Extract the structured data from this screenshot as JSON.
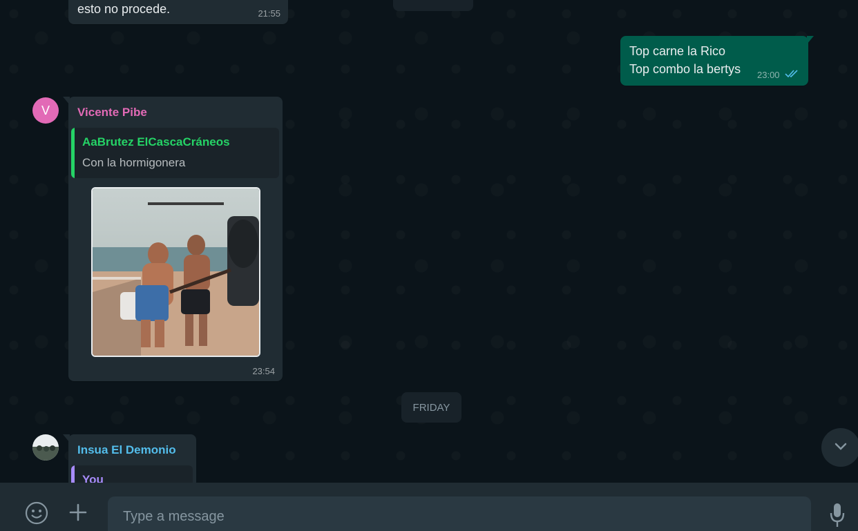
{
  "messages": {
    "m1": {
      "text": "esto no procede.",
      "time": "21:55"
    },
    "m2": {
      "line1": "Top carne la Rico",
      "line2": "Top combo la bertys",
      "time": "23:00"
    },
    "m3": {
      "avatar_letter": "V",
      "sender": "Vicente Pibe",
      "quote_author": "AaBrutez ElCascaCráneos",
      "quote_text": "Con la hormigonera",
      "time": "23:54"
    },
    "m4": {
      "sender": "Insua El Demonio",
      "quote_author": "You"
    }
  },
  "date_chip": "FRIDAY",
  "composer": {
    "placeholder": "Type a message"
  },
  "icons": {
    "emoji": "emoji-icon",
    "attach": "plus-icon",
    "mic": "mic-icon",
    "scroll": "chevron-down-icon",
    "read": "double-check-icon"
  },
  "colors": {
    "background": "#0b141a",
    "incoming": "#202c33",
    "outgoing": "#005c4b",
    "sender_vicente": "#e26ab6",
    "quote_green": "#25d366",
    "sender_insua": "#53bdeb",
    "quote_you": "#a78bfa",
    "read_tick": "#53bdeb"
  }
}
